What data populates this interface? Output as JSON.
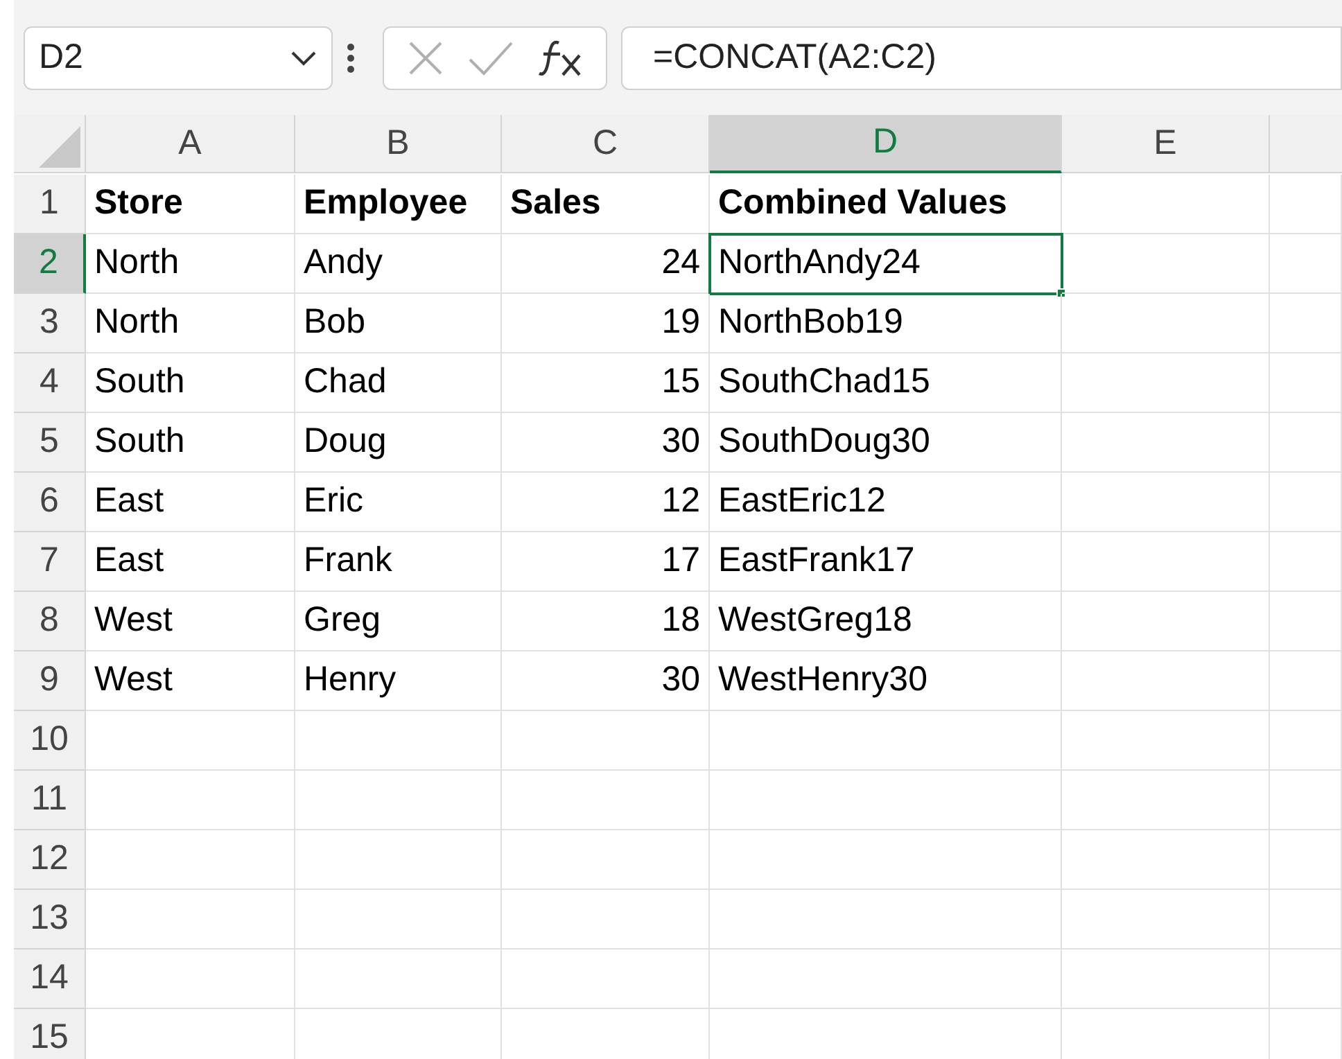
{
  "name_box": {
    "value": "D2"
  },
  "formula_bar": {
    "value": "=CONCAT(A2:C2)"
  },
  "columns": [
    {
      "label": "A",
      "selected": false
    },
    {
      "label": "B",
      "selected": false
    },
    {
      "label": "C",
      "selected": false
    },
    {
      "label": "D",
      "selected": true
    },
    {
      "label": "E",
      "selected": false
    }
  ],
  "rows": [
    {
      "number": "1",
      "selected": false,
      "cells": [
        {
          "text": "Store",
          "kind": "header",
          "selected": false
        },
        {
          "text": "Employee",
          "kind": "header",
          "selected": false
        },
        {
          "text": "Sales",
          "kind": "header",
          "selected": false
        },
        {
          "text": "Combined Values",
          "kind": "header",
          "selected": false
        }
      ]
    },
    {
      "number": "2",
      "selected": true,
      "cells": [
        {
          "text": "North",
          "kind": "text",
          "selected": false
        },
        {
          "text": "Andy",
          "kind": "text",
          "selected": false
        },
        {
          "text": "24",
          "kind": "number",
          "selected": false
        },
        {
          "text": "NorthAndy24",
          "kind": "text",
          "selected": true
        }
      ]
    },
    {
      "number": "3",
      "selected": false,
      "cells": [
        {
          "text": "North",
          "kind": "text",
          "selected": false
        },
        {
          "text": "Bob",
          "kind": "text",
          "selected": false
        },
        {
          "text": "19",
          "kind": "number",
          "selected": false
        },
        {
          "text": "NorthBob19",
          "kind": "text",
          "selected": false
        }
      ]
    },
    {
      "number": "4",
      "selected": false,
      "cells": [
        {
          "text": "South",
          "kind": "text",
          "selected": false
        },
        {
          "text": "Chad",
          "kind": "text",
          "selected": false
        },
        {
          "text": "15",
          "kind": "number",
          "selected": false
        },
        {
          "text": "SouthChad15",
          "kind": "text",
          "selected": false
        }
      ]
    },
    {
      "number": "5",
      "selected": false,
      "cells": [
        {
          "text": "South",
          "kind": "text",
          "selected": false
        },
        {
          "text": "Doug",
          "kind": "text",
          "selected": false
        },
        {
          "text": "30",
          "kind": "number",
          "selected": false
        },
        {
          "text": "SouthDoug30",
          "kind": "text",
          "selected": false
        }
      ]
    },
    {
      "number": "6",
      "selected": false,
      "cells": [
        {
          "text": "East",
          "kind": "text",
          "selected": false
        },
        {
          "text": "Eric",
          "kind": "text",
          "selected": false
        },
        {
          "text": "12",
          "kind": "number",
          "selected": false
        },
        {
          "text": "EastEric12",
          "kind": "text",
          "selected": false
        }
      ]
    },
    {
      "number": "7",
      "selected": false,
      "cells": [
        {
          "text": "East",
          "kind": "text",
          "selected": false
        },
        {
          "text": "Frank",
          "kind": "text",
          "selected": false
        },
        {
          "text": "17",
          "kind": "number",
          "selected": false
        },
        {
          "text": "EastFrank17",
          "kind": "text",
          "selected": false
        }
      ]
    },
    {
      "number": "8",
      "selected": false,
      "cells": [
        {
          "text": "West",
          "kind": "text",
          "selected": false
        },
        {
          "text": "Greg",
          "kind": "text",
          "selected": false
        },
        {
          "text": "18",
          "kind": "number",
          "selected": false
        },
        {
          "text": "WestGreg18",
          "kind": "text",
          "selected": false
        }
      ]
    },
    {
      "number": "9",
      "selected": false,
      "cells": [
        {
          "text": "West",
          "kind": "text",
          "selected": false
        },
        {
          "text": "Henry",
          "kind": "text",
          "selected": false
        },
        {
          "text": "30",
          "kind": "number",
          "selected": false
        },
        {
          "text": "WestHenry30",
          "kind": "text",
          "selected": false
        }
      ]
    },
    {
      "number": "10",
      "selected": false,
      "cells": []
    },
    {
      "number": "11",
      "selected": false,
      "cells": []
    },
    {
      "number": "12",
      "selected": false,
      "cells": []
    },
    {
      "number": "13",
      "selected": false,
      "cells": []
    },
    {
      "number": "14",
      "selected": false,
      "cells": []
    },
    {
      "number": "15",
      "selected": false,
      "cells": []
    }
  ]
}
